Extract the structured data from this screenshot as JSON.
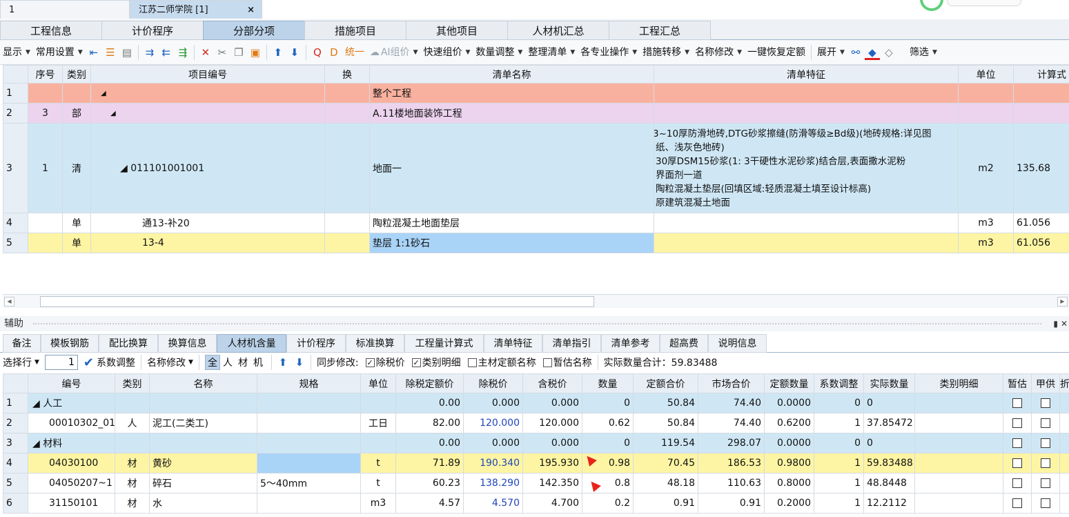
{
  "doc_tabs": {
    "first": "1",
    "second": "江苏二师学院 [1]",
    "close": "×"
  },
  "main_tabs": [
    "工程信息",
    "计价程序",
    "分部分项",
    "措施项目",
    "其他项目",
    "人材机汇总",
    "工程汇总"
  ],
  "main_tab_active": 2,
  "toolbar": {
    "display": "显示",
    "common": "常用设置",
    "unify": "统一",
    "ai": "AI组价",
    "quick": "快速组价",
    "qty_adjust": "数量调整",
    "organize": "整理清单",
    "specialty": "各专业操作",
    "measure_move": "措施转移",
    "rename": "名称修改",
    "restore": "一键恢复定额",
    "expand": "展开",
    "filter": "筛选"
  },
  "top_grid": {
    "headers": [
      "序号",
      "类别",
      "项目编号",
      "换",
      "清单名称",
      "清单特征",
      "单位",
      "计算式"
    ],
    "rows": [
      {
        "idx": "1",
        "seq": "",
        "type": "",
        "code": "◢",
        "name": "整个工程",
        "feature": "",
        "unit": "",
        "calc": ""
      },
      {
        "idx": "2",
        "seq": "3",
        "type": "部",
        "code": "◢",
        "name": "A.11楼地面装饰工程",
        "feature": "",
        "unit": "",
        "calc": ""
      },
      {
        "idx": "3",
        "seq": "1",
        "type": "清",
        "code": "◢ 011101001001",
        "name": "地面一",
        "feature": "3~10厚防滑地砖,DTG砂浆擦缝(防滑等级≥Bd级)(地砖规格:详见图\n纸、浅灰色地砖)\n30厚DSM15砂浆(1: 3干硬性水泥砂浆)结合层,表面撒水泥粉\n界面剂一道\n陶粒混凝土垫层(回填区域:轻质混凝土填至设计标高)\n原建筑混凝土地面",
        "unit": "m2",
        "calc": "135.68"
      },
      {
        "idx": "4",
        "seq": "",
        "type": "单",
        "code": "通13-补20",
        "name": "陶粒混凝土地面垫层",
        "feature": "",
        "unit": "m3",
        "calc": "61.056"
      },
      {
        "idx": "5",
        "seq": "",
        "type": "单",
        "code": "13-4",
        "name": "垫层  1:1砂石",
        "feature": "",
        "unit": "m3",
        "calc": "61.056"
      }
    ]
  },
  "aux": {
    "title": "辅助",
    "tabs": [
      "备注",
      "模板钢筋",
      "配比换算",
      "换算信息",
      "人材机含量",
      "计价程序",
      "标准换算",
      "工程量计算式",
      "清单特征",
      "清单指引",
      "清单参考",
      "超高费",
      "说明信息"
    ],
    "active_tab": 4,
    "toolbar": {
      "select_row": "选择行",
      "row_value": "1",
      "coef_adjust": "系数调整",
      "name_modify": "名称修改",
      "seg_all": "全",
      "seg_ren": "人",
      "seg_cai": "材",
      "seg_ji": "机",
      "sync": "同步修改:",
      "cb_tax": "除税价",
      "cb_cat": "类别明细",
      "cb_main": "主材定额名称",
      "cb_est": "暂估名称",
      "actual_total": "实际数量合计：59.83488"
    }
  },
  "bottom_grid": {
    "headers": [
      "编号",
      "类别",
      "名称",
      "规格",
      "单位",
      "除税定额价",
      "除税价",
      "含税价",
      "数量",
      "定额合价",
      "市场合价",
      "定额数量",
      "系数调整",
      "实际数量",
      "类别明细",
      "暂估",
      "甲供",
      "折"
    ],
    "rows": [
      {
        "idx": "1",
        "code": "◢ 人工",
        "type": "",
        "name": "",
        "spec": "",
        "unit": "",
        "quota_price": "0.00",
        "ex_tax": "0.000",
        "inc_tax": "0.000",
        "qty": "0",
        "quota_total": "50.84",
        "market_total": "74.40",
        "quota_qty": "0.0000",
        "coef": "0",
        "actual": "0",
        "style": "lightblue"
      },
      {
        "idx": "2",
        "code": "00010302_01",
        "type": "人",
        "name": "泥工(二类工)",
        "spec": "",
        "unit": "工日",
        "quota_price": "82.00",
        "ex_tax": "120.000",
        "inc_tax": "120.000",
        "qty": "0.62",
        "quota_total": "50.84",
        "market_total": "74.40",
        "quota_qty": "0.6200",
        "coef": "1",
        "actual": "37.85472",
        "style": "white"
      },
      {
        "idx": "3",
        "code": "◢ 材料",
        "type": "",
        "name": "",
        "spec": "",
        "unit": "",
        "quota_price": "0.00",
        "ex_tax": "0.000",
        "inc_tax": "0.000",
        "qty": "0",
        "quota_total": "119.54",
        "market_total": "298.07",
        "quota_qty": "0.0000",
        "coef": "0",
        "actual": "0",
        "style": "lightblue"
      },
      {
        "idx": "4",
        "code": "04030100",
        "type": "材",
        "name": "黄砂",
        "spec": "",
        "unit": "t",
        "quota_price": "71.89",
        "ex_tax": "190.340",
        "inc_tax": "195.930",
        "qty": "0.98",
        "quota_total": "70.45",
        "market_total": "186.53",
        "quota_qty": "0.9800",
        "coef": "1",
        "actual": "59.83488",
        "style": "yellow"
      },
      {
        "idx": "5",
        "code": "04050207~1",
        "type": "材",
        "name": "碎石",
        "spec": "5～40mm",
        "unit": "t",
        "quota_price": "60.23",
        "ex_tax": "138.290",
        "inc_tax": "142.350",
        "qty": "0.8",
        "quota_total": "48.18",
        "market_total": "110.63",
        "quota_qty": "0.8000",
        "coef": "1",
        "actual": "48.8448",
        "style": "white"
      },
      {
        "idx": "6",
        "code": "31150101",
        "type": "材",
        "name": "水",
        "spec": "",
        "unit": "m3",
        "quota_price": "4.57",
        "ex_tax": "4.570",
        "inc_tax": "4.700",
        "qty": "0.2",
        "quota_total": "0.91",
        "market_total": "0.91",
        "quota_qty": "0.2000",
        "coef": "1",
        "actual": "12.2112",
        "style": "white"
      }
    ]
  }
}
